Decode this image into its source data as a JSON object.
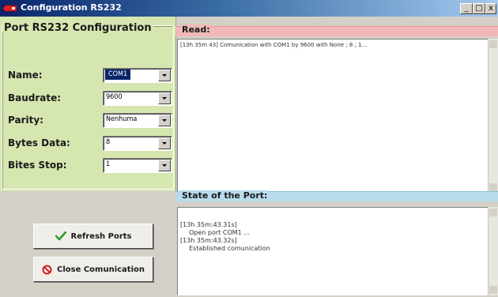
{
  "window": {
    "title": "Configuration RS232",
    "controls": {
      "minimize": "_",
      "maximize": "□",
      "close": "x"
    }
  },
  "config": {
    "header": "Port RS232 Configuration",
    "fields": [
      {
        "label": "Name:",
        "value": "COM1"
      },
      {
        "label": "Baudrate:",
        "value": "9600"
      },
      {
        "label": "Parity:",
        "value": "Nenhuma"
      },
      {
        "label": "Bytes Data:",
        "value": "8"
      },
      {
        "label": "Bites Stop:",
        "value": "1"
      }
    ]
  },
  "buttons": {
    "refresh": "Refresh Ports",
    "close": "Close Comunication"
  },
  "read": {
    "header": "Read:",
    "text": "[13h 35m 43] Comunication with COM1 by 9600 with None ; 8 ; 1..."
  },
  "state": {
    "header": "State of the Port:",
    "lines": [
      "[13h 35m:43.31s]",
      "Open port COM1 ...",
      "[13h 35m:43.32s]",
      "Established comunication"
    ]
  },
  "colors": {
    "config_bg": "#d6e6b0",
    "read_header": "#f0b8b8",
    "state_header": "#b8dcec",
    "check_green": "#2e9b2e",
    "stop_red": "#d02020"
  },
  "icons": {
    "app": "serial-port-icon",
    "refresh": "check-icon",
    "close": "stop-icon"
  }
}
